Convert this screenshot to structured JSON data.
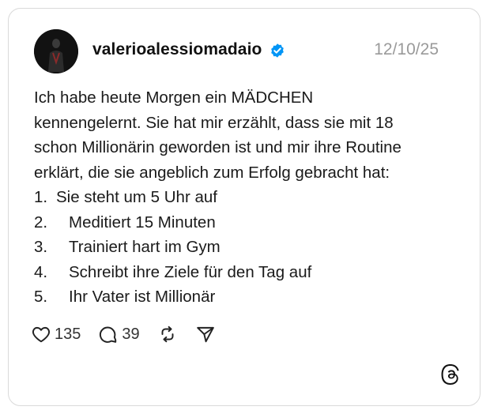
{
  "post": {
    "username": "valerioalessiomadaio",
    "date": "12/10/25",
    "intro_lines": [
      "Ich habe heute Morgen ein MÄDCHEN",
      "kennengelernt. Sie hat mir erzählt, dass sie mit 18",
      "schon Millionärin geworden ist und mir ihre Routine",
      "erklärt, die sie angeblich zum Erfolg gebracht hat:"
    ],
    "list": [
      {
        "num": "1.",
        "text": "Sie steht um 5 Uhr auf"
      },
      {
        "num": "2.",
        "text": "Meditiert 15 Minuten"
      },
      {
        "num": "3.",
        "text": "Trainiert hart im Gym"
      },
      {
        "num": "4.",
        "text": "Schreibt ihre Ziele für den Tag auf"
      },
      {
        "num": "5.",
        "text": "Ihr Vater ist Millionär"
      }
    ],
    "likes": "135",
    "comments": "39"
  },
  "icons": {
    "verified": "verified-badge-icon",
    "like": "heart-icon",
    "comment": "comment-bubble-icon",
    "repost": "repost-icon",
    "share": "send-icon",
    "brand": "threads-logo-icon"
  },
  "colors": {
    "verified_badge": "#0095f6",
    "date_text": "#9a9a9a",
    "border": "#d9d9d9"
  }
}
